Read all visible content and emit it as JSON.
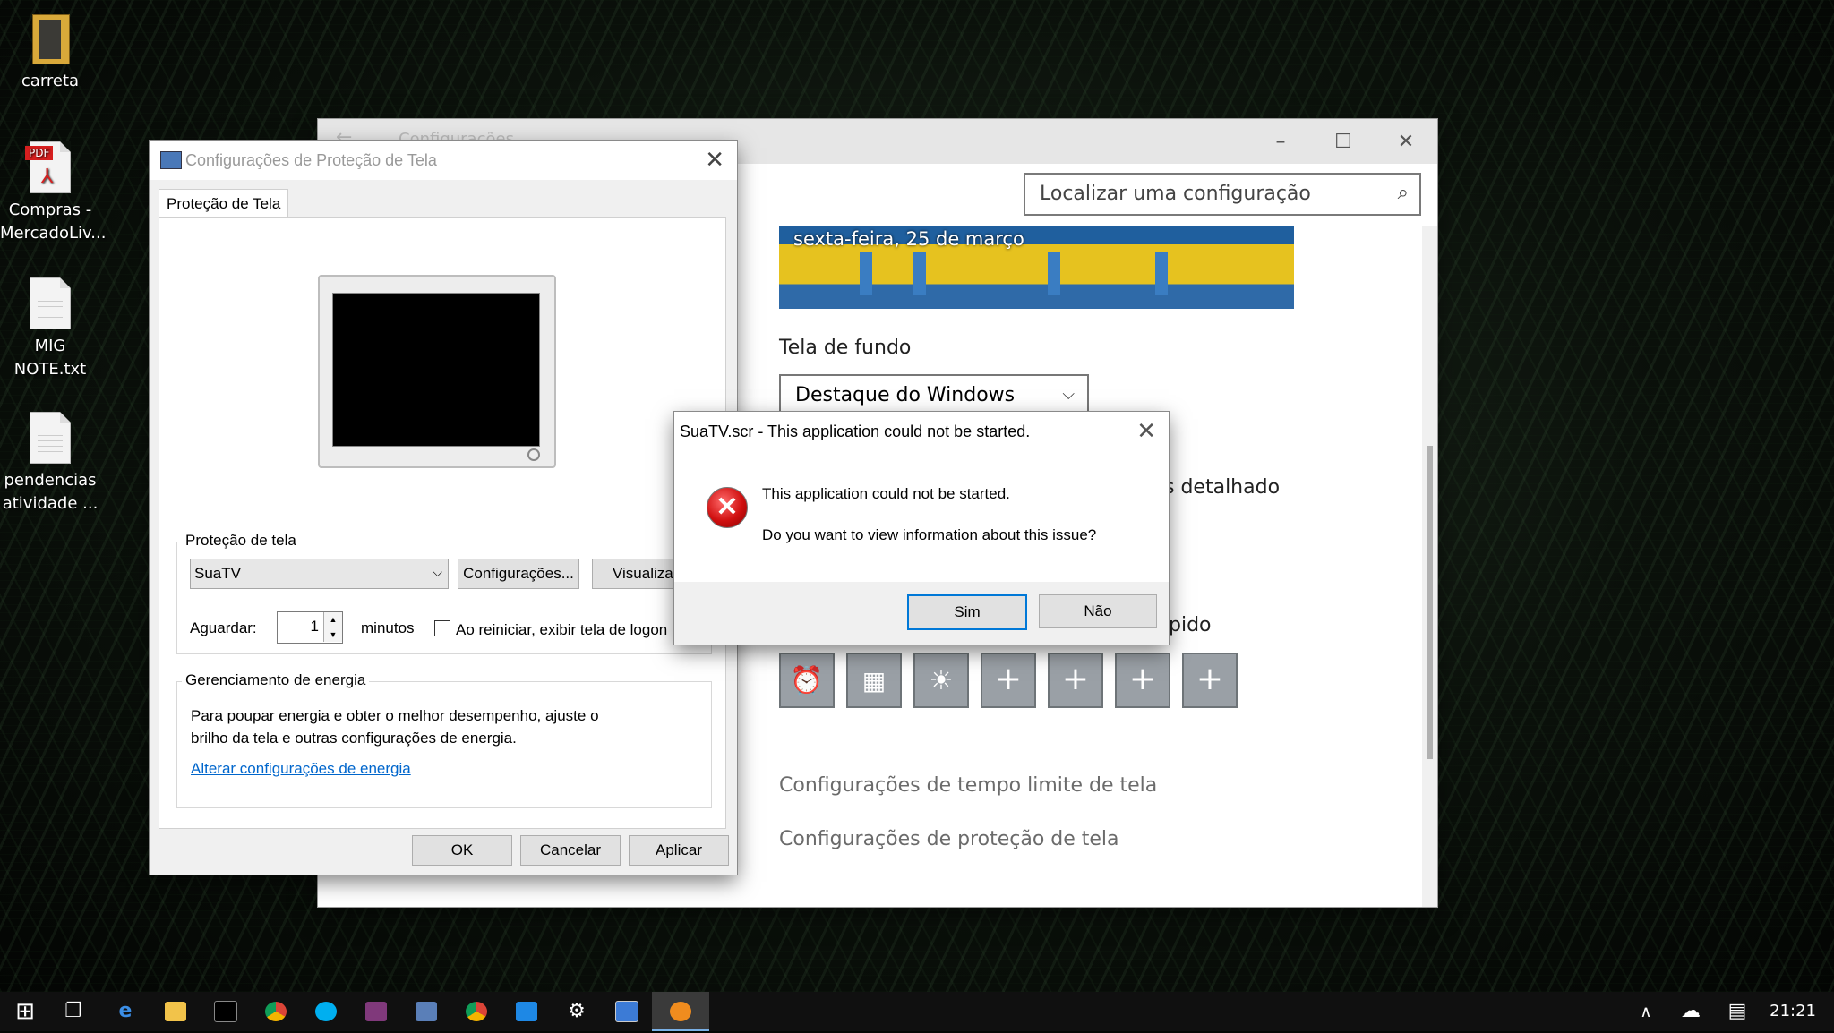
{
  "desktop": {
    "icons": [
      {
        "label": "carreta"
      },
      {
        "label": "Compras - MercadoLiv..."
      },
      {
        "label": "MIG NOTE.txt"
      },
      {
        "label": "pendencias atividade ..."
      }
    ],
    "pdf_badge": "PDF"
  },
  "settings_window": {
    "title": "Configurações",
    "search_placeholder": "Localizar uma configuração",
    "hero_date": "sexta-feira, 25 de março",
    "background_label": "Tela de fundo",
    "background_value": "Destaque do Windows",
    "partial_label_1": "s detalhado",
    "partial_label_2": "pido",
    "quick_actions": [
      "alarm-icon",
      "calendar-icon",
      "brightness-icon",
      "add-icon",
      "add-icon",
      "add-icon",
      "add-icon"
    ],
    "link_timeout": "Configurações de tempo limite de tela",
    "link_screensaver": "Configurações de proteção de tela"
  },
  "screensaver_dialog": {
    "title": "Configurações de Proteção de Tela",
    "tab": "Proteção de Tela",
    "group_screensaver": "Proteção de tela",
    "selected_screensaver": "SuaTV",
    "settings_button": "Configurações...",
    "preview_button": "Visualizar",
    "wait_label": "Aguardar:",
    "wait_value": "1",
    "minutes_label": "minutos",
    "logon_checkbox_label": "Ao reiniciar, exibir tela de logon",
    "group_power": "Gerenciamento de energia",
    "power_text_1": "Para poupar energia e obter o melhor desempenho, ajuste o",
    "power_text_2": "brilho da tela e outras configurações de energia.",
    "power_link": "Alterar configurações de energia",
    "ok": "OK",
    "cancel": "Cancelar",
    "apply": "Aplicar"
  },
  "error_dialog": {
    "title": "SuaTV.scr - This application could not be started.",
    "message_1": "This application could not be started.",
    "message_2": "Do you want to view information about this issue?",
    "yes": "Sim",
    "no": "Não"
  },
  "taskbar": {
    "clock": "21:21"
  },
  "colors": {
    "accent": "#0078d7",
    "link": "#0066cc",
    "error_red": "#d01010"
  }
}
